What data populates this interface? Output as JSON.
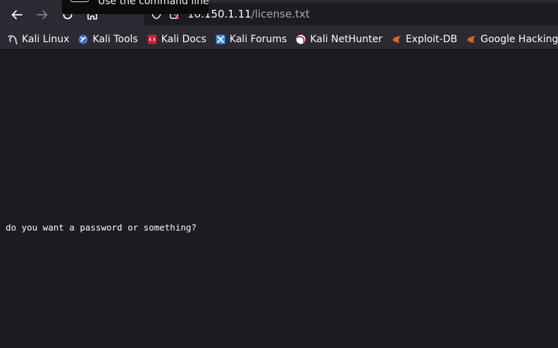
{
  "browser": {
    "url_host": "10.150.1.11",
    "url_path": "/license.txt",
    "tooltip": "Use the command line"
  },
  "bookmarks": [
    {
      "label": "Kali Linux",
      "icon": "kali-dragon-icon"
    },
    {
      "label": "Kali Tools",
      "icon": "kali-tools-icon"
    },
    {
      "label": "Kali Docs",
      "icon": "kali-docs-icon"
    },
    {
      "label": "Kali Forums",
      "icon": "kali-forums-icon"
    },
    {
      "label": "Kali NetHunter",
      "icon": "kali-nethunter-icon"
    },
    {
      "label": "Exploit-DB",
      "icon": "exploit-db-icon"
    },
    {
      "label": "Google Hacking DB",
      "icon": "google-hacking-db-icon"
    }
  ],
  "page": {
    "text": "do you want a password or something?"
  },
  "colors": {
    "toolbar": "#2b2a33",
    "page_bg": "#1c1b22",
    "text": "#fbfbfe",
    "exploit_orange": "#e0622a",
    "docs_red": "#d0213a",
    "tools_blue": "#3d6fe0"
  }
}
